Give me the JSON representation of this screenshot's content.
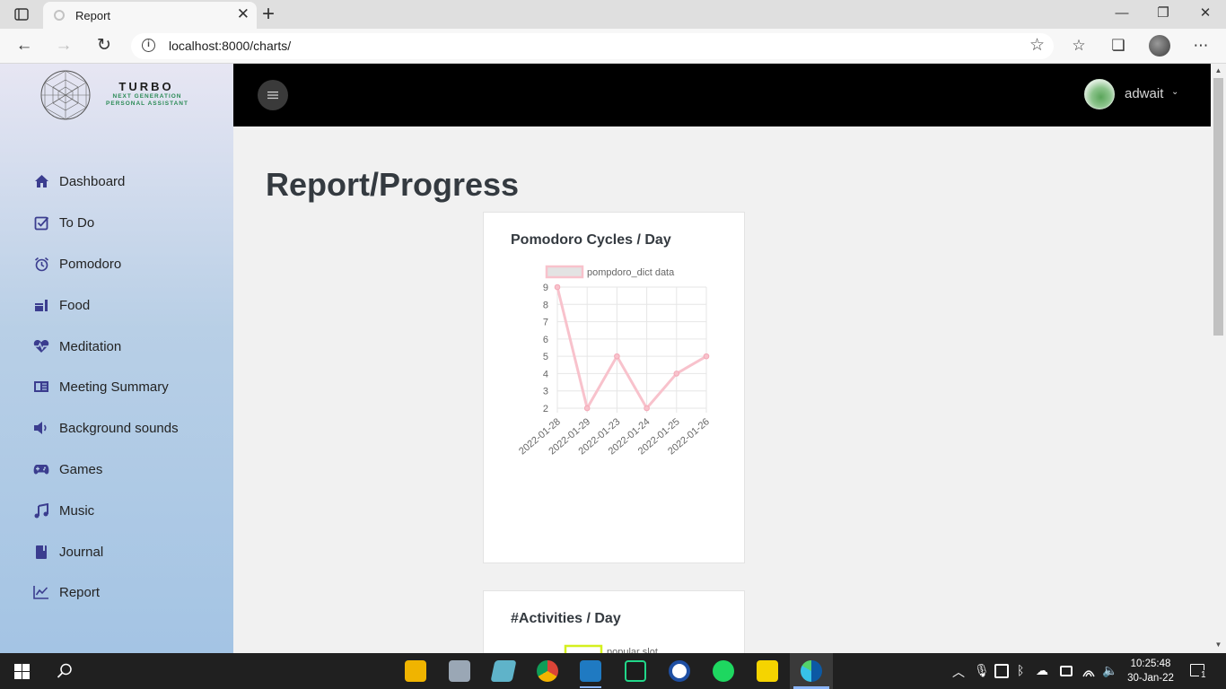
{
  "browser": {
    "tab_title": "Report",
    "url": "localhost:8000/charts/"
  },
  "brand": {
    "name": "TURBO",
    "tagline_line1": "NEXT GENERATION",
    "tagline_line2": "PERSONAL ASSISTANT"
  },
  "sidebar": {
    "items": [
      {
        "label": "Dashboard",
        "icon": "home-icon"
      },
      {
        "label": "To Do",
        "icon": "checkbox-icon"
      },
      {
        "label": "Pomodoro",
        "icon": "alarm-clock-icon"
      },
      {
        "label": "Food",
        "icon": "food-icon"
      },
      {
        "label": "Meditation",
        "icon": "heartbeat-icon"
      },
      {
        "label": "Meeting Summary",
        "icon": "book-open-icon"
      },
      {
        "label": "Background sounds",
        "icon": "volume-icon"
      },
      {
        "label": "Games",
        "icon": "gamepad-icon"
      },
      {
        "label": "Music",
        "icon": "music-note-icon"
      },
      {
        "label": "Journal",
        "icon": "journal-icon"
      },
      {
        "label": "Report",
        "icon": "line-chart-icon"
      }
    ]
  },
  "topbar": {
    "username": "adwait"
  },
  "main": {
    "title": "Report/Progress"
  },
  "chart_data": [
    {
      "type": "line",
      "title": "Pomodoro Cycles / Day",
      "x": [
        "2022-01-28",
        "2022-01-29",
        "2022-01-23",
        "2022-01-24",
        "2022-01-25",
        "2022-01-26"
      ],
      "series": [
        {
          "name": "pompdoro_dict data",
          "values": [
            9,
            2,
            5,
            2,
            4,
            5
          ],
          "color": "#f8c2cc"
        }
      ],
      "ylim": [
        2,
        9
      ],
      "yticks": [
        "9",
        "8",
        "7",
        "6",
        "5",
        "4",
        "3",
        "2"
      ],
      "grid": true,
      "legend": "top"
    },
    {
      "type": "bar",
      "title": "#Activities / Day",
      "series": [
        {
          "name": "popular slot",
          "color": "#d4f01e"
        }
      ],
      "legend": "top"
    }
  ],
  "taskbar": {
    "time": "10:25:48",
    "date": "30-Jan-22",
    "notification_count": "1"
  }
}
